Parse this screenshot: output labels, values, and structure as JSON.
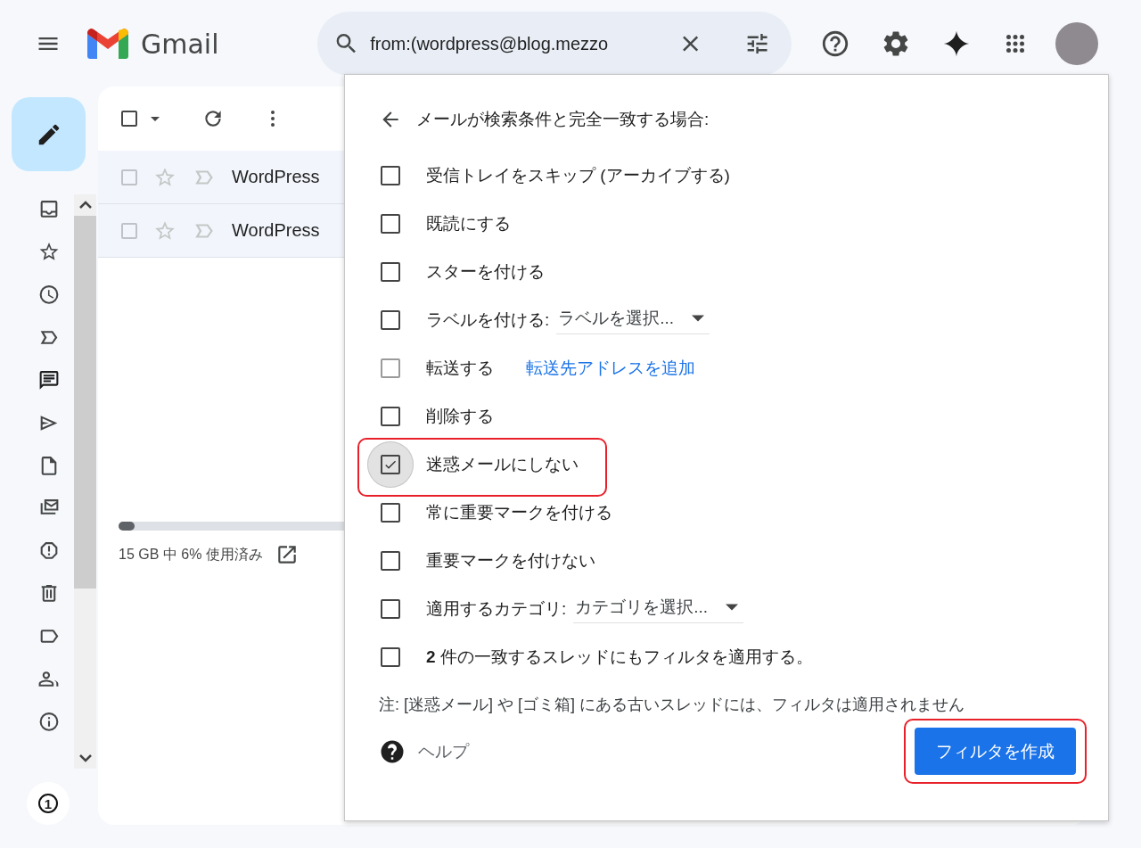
{
  "header": {
    "app_name": "Gmail",
    "search": {
      "value": "from:(wordpress@blog.mezzo"
    }
  },
  "rail": {
    "badge": "1"
  },
  "mail_list": {
    "select_all": {
      "checked": false
    },
    "rows": [
      {
        "sender": "WordPress",
        "checked": false,
        "starred": false
      },
      {
        "sender": "WordPress",
        "checked": false,
        "starred": false
      }
    ],
    "storage": {
      "level": 0.06,
      "text": "15 GB 中 6% 使用済み"
    }
  },
  "filter_dialog": {
    "title": "メールが検索条件と完全一致する場合:",
    "options": [
      {
        "kind": "checkbox",
        "label": "受信トレイをスキップ (アーカイブする)",
        "checked": false,
        "disabled": false,
        "highlighted": false
      },
      {
        "kind": "checkbox",
        "label": "既読にする",
        "checked": false,
        "disabled": false,
        "highlighted": false
      },
      {
        "kind": "checkbox",
        "label": "スターを付ける",
        "checked": false,
        "disabled": false,
        "highlighted": false
      },
      {
        "kind": "select",
        "label": "ラベルを付ける:",
        "value": "ラベルを選択...",
        "checked": false,
        "disabled": false,
        "highlighted": false
      },
      {
        "kind": "link",
        "label": "転送する",
        "link": "転送先アドレスを追加",
        "checked": false,
        "disabled": true,
        "highlighted": false
      },
      {
        "kind": "checkbox",
        "label": "削除する",
        "checked": false,
        "disabled": false,
        "highlighted": false
      },
      {
        "kind": "checkbox",
        "label": "迷惑メールにしない",
        "checked": true,
        "disabled": false,
        "highlighted": true
      },
      {
        "kind": "checkbox",
        "label": "常に重要マークを付ける",
        "checked": false,
        "disabled": false,
        "highlighted": false
      },
      {
        "kind": "checkbox",
        "label": "重要マークを付けない",
        "checked": false,
        "disabled": false,
        "highlighted": false
      },
      {
        "kind": "select",
        "label": "適用するカテゴリ:",
        "value": "カテゴリを選択...",
        "checked": false,
        "disabled": false,
        "highlighted": false
      },
      {
        "kind": "checkbox",
        "label": "**2** 件の一致するスレッドにもフィルタを適用する。",
        "checked": false,
        "disabled": false,
        "highlighted": false
      }
    ],
    "note": "注: [迷惑メール] や [ゴミ箱] にある古いスレッドには、フィルタは適用されません",
    "help": "ヘルプ",
    "create_button": {
      "label": "フィルタを作成",
      "highlighted": true
    }
  }
}
